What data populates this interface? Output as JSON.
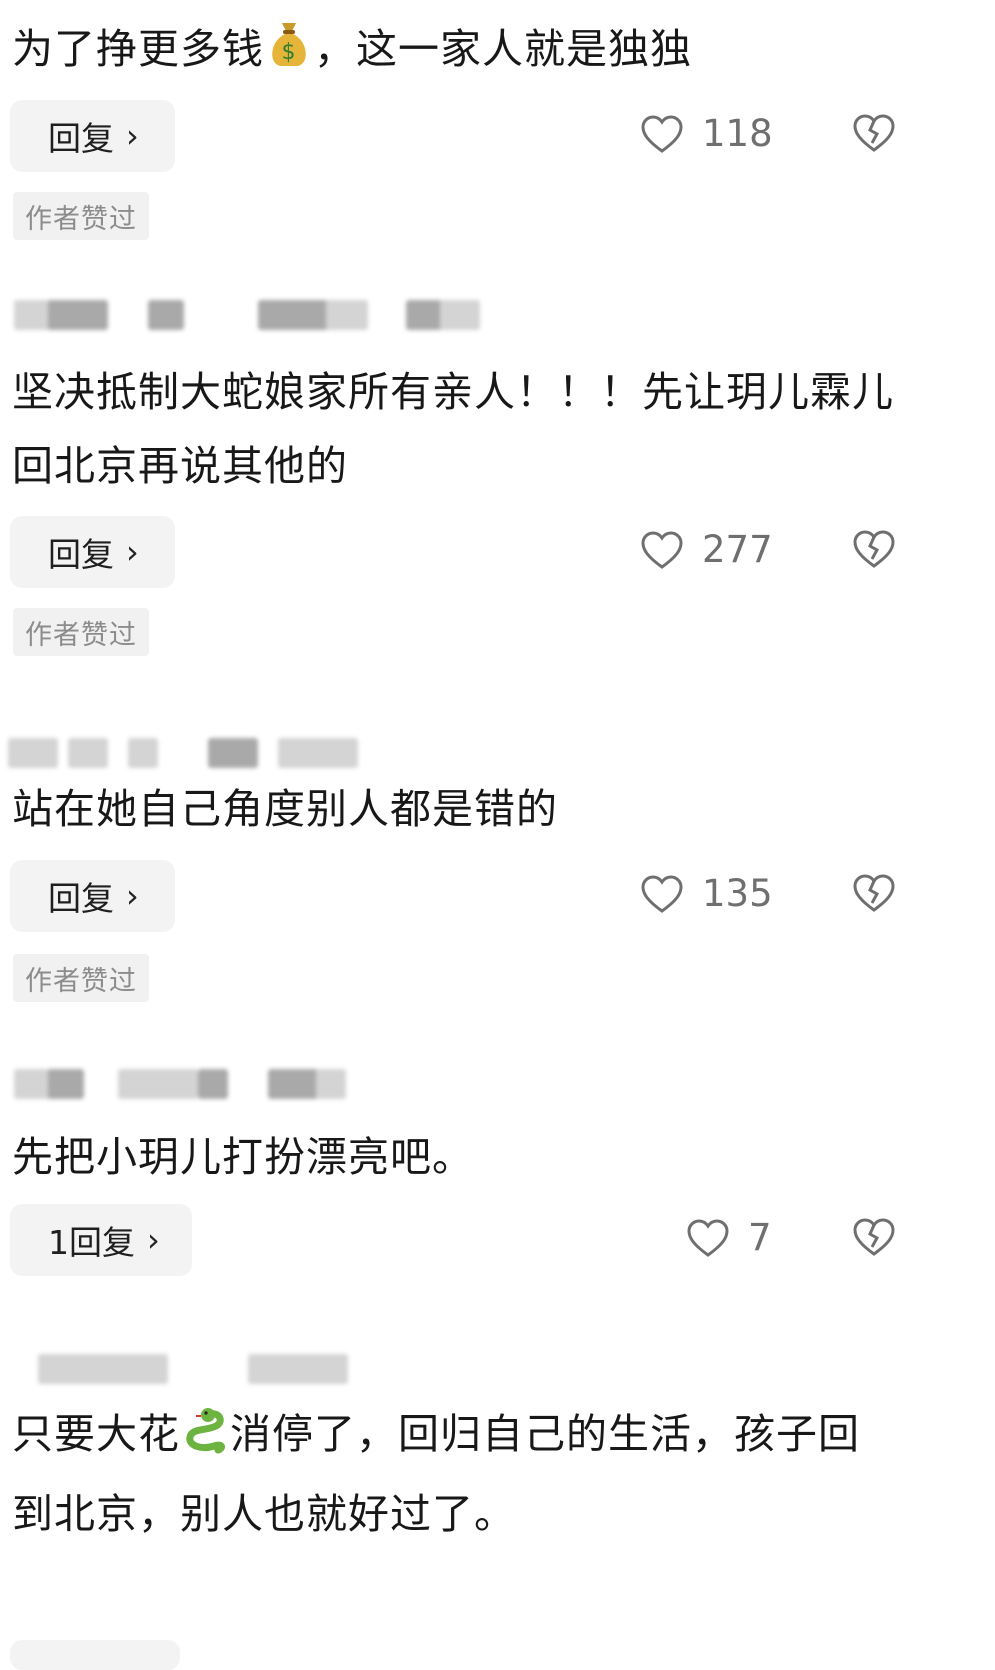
{
  "comments": [
    {
      "text": "为了挣更多钱",
      "text_after": "，这一家人就是独独",
      "emoji": "money-bag-icon",
      "reply_label": "回复",
      "likes": "118",
      "badge": "作者赞过"
    },
    {
      "text": "坚决抵制大蛇娘家所有亲人！！！先让玥儿霖儿回北京再说其他的",
      "reply_label": "回复",
      "likes": "277",
      "badge": "作者赞过"
    },
    {
      "text": "站在她自己角度别人都是错的",
      "reply_label": "回复",
      "likes": "135",
      "badge": "作者赞过"
    },
    {
      "text": "先把小玥儿打扮漂亮吧。",
      "reply_label": "1回复",
      "likes": "7"
    },
    {
      "text": "只要大花",
      "text_after": "消停了，回归自己的生活，孩子回到北京，别人也就好过了。",
      "emoji": "snake-icon"
    }
  ],
  "colors": {
    "button_bg": "#f3f3f3",
    "badge_bg": "#f1f1f1",
    "icon_gray": "#6f6f6f"
  }
}
